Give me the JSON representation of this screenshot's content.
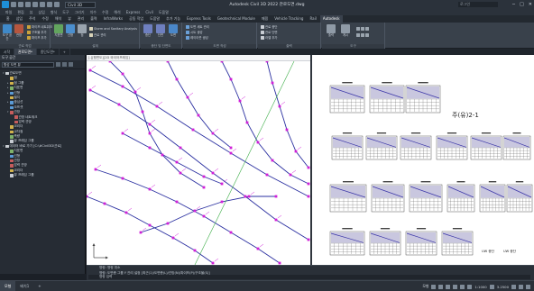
{
  "title": {
    "workspace": "Civil 3D",
    "window_title": "Autodesk Civil 3D 2022   관로도면.dwg",
    "signin": "로그인",
    "controls": [
      "─",
      "□",
      "✕"
    ]
  },
  "menu": [
    "파일",
    "편집",
    "뷰",
    "삽입",
    "형식",
    "도구",
    "그리기",
    "치수",
    "수정",
    "해석",
    "Express",
    "Civil",
    "도움말"
  ],
  "ribbon_tabs": [
    {
      "label": "홈",
      "active": false
    },
    {
      "label": "삽입",
      "active": false
    },
    {
      "label": "주석",
      "active": false
    },
    {
      "label": "수정",
      "active": false
    },
    {
      "label": "해석",
      "active": false
    },
    {
      "label": "뷰",
      "active": false
    },
    {
      "label": "관리",
      "active": false
    },
    {
      "label": "출력",
      "active": false
    },
    {
      "label": "InfraWorks",
      "active": false
    },
    {
      "label": "공동 작업",
      "active": false
    },
    {
      "label": "도움말",
      "active": false
    },
    {
      "label": "추가 기능",
      "active": false
    },
    {
      "label": "Express Tools",
      "active": false
    },
    {
      "label": "Geotechnical Module",
      "active": false
    },
    {
      "label": "매핑",
      "active": false
    },
    {
      "label": "Vehicle Tracking",
      "active": false
    },
    {
      "label": "Rail",
      "active": false
    },
    {
      "label": "Autodesk",
      "active": true
    }
  ],
  "ribbon": {
    "panels": [
      {
        "title": "관로 작업"
      },
      {
        "title": "설계"
      },
      {
        "title": "종단 및 단면도"
      },
      {
        "title": "도면 작성"
      },
      {
        "title": "출력"
      },
      {
        "title": "도구"
      }
    ],
    "big_buttons": [
      "도구 공간",
      "관망",
      "지표면",
      "선형",
      "점",
      "종단",
      "단면",
      "도면",
      "출력",
      "게시"
    ],
    "small_buttons": [
      "파이프 네트워크",
      "구조물 추가",
      "파이프 추가",
      "Storm and Sanitary Analysis",
      "관로 관리",
      "도면 세트 관리",
      "시트 생성",
      "레이아웃 생성",
      "관로 종단",
      "관로 단면",
      "라벨 추가"
    ]
  },
  "doc_tabs": [
    {
      "label": "시작",
      "active": false
    },
    {
      "label": "관로도면*",
      "active": true
    },
    {
      "label": "종단도면*",
      "active": false
    },
    {
      "label": "+",
      "active": false
    }
  ],
  "toolspace": {
    "title": "도구 공간",
    "combo": "활성 도면 뷰",
    "tree": [
      {
        "label": "관로도면",
        "depth": 0,
        "icon": "w",
        "tw": "▾"
      },
      {
        "label": "점",
        "depth": 1,
        "icon": "y",
        "tw": ""
      },
      {
        "label": "점 그룹",
        "depth": 1,
        "icon": "y",
        "tw": "▸"
      },
      {
        "label": "지표면",
        "depth": 1,
        "icon": "g",
        "tw": "▸"
      },
      {
        "label": "선형",
        "depth": 1,
        "icon": "b",
        "tw": "▸"
      },
      {
        "label": "필지",
        "depth": 1,
        "icon": "y",
        "tw": ""
      },
      {
        "label": "중심선",
        "depth": 1,
        "icon": "b",
        "tw": "▸"
      },
      {
        "label": "오프셋",
        "depth": 1,
        "icon": "b",
        "tw": ""
      },
      {
        "label": "관망",
        "depth": 1,
        "icon": "r",
        "tw": "▾"
      },
      {
        "label": "관망 네트워크",
        "depth": 2,
        "icon": "r",
        "tw": ""
      },
      {
        "label": "압력 관망",
        "depth": 2,
        "icon": "r",
        "tw": ""
      },
      {
        "label": "코리더",
        "depth": 1,
        "icon": "y",
        "tw": ""
      },
      {
        "label": "교차점",
        "depth": 1,
        "icon": "y",
        "tw": ""
      },
      {
        "label": "측량",
        "depth": 1,
        "icon": "g",
        "tw": ""
      },
      {
        "label": "뷰 프레임 그룹",
        "depth": 1,
        "icon": "w",
        "tw": ""
      },
      {
        "label": "데이터 바로 가기 [C:\\#Civil3D\\관로]",
        "depth": 0,
        "icon": "w",
        "tw": "▾"
      },
      {
        "label": "지표면",
        "depth": 1,
        "icon": "g",
        "tw": ""
      },
      {
        "label": "선형",
        "depth": 1,
        "icon": "b",
        "tw": ""
      },
      {
        "label": "관망",
        "depth": 1,
        "icon": "r",
        "tw": ""
      },
      {
        "label": "압력 관망",
        "depth": 1,
        "icon": "r",
        "tw": ""
      },
      {
        "label": "코리더",
        "depth": 1,
        "icon": "y",
        "tw": ""
      },
      {
        "label": "뷰 프레임 그룹",
        "depth": 1,
        "icon": "w",
        "tw": ""
      }
    ]
  },
  "model_view": {
    "viewport_label": "[-][평면도][2D 와이어프레임]"
  },
  "layout": {
    "sheet_title": "주(유)2-1",
    "labels": [
      "UW 종단",
      "UW 종단"
    ]
  },
  "command_line": {
    "history": [
      "명령: 명령 취소",
      "명령: 도면층 그룹 Y 관리 설정 [최근(1)/도면층(L)/관망(N)/파이프(P)/구조물(S)]"
    ],
    "input": "명령 입력"
  },
  "status": {
    "tabs": [
      {
        "label": "모형",
        "active": true
      },
      {
        "label": "배치1",
        "active": false
      },
      {
        "label": "+",
        "active": false
      }
    ],
    "scale": "1:1000",
    "coords": "3.2500",
    "mode": "모형"
  },
  "colors": {
    "pipe": "#2a2fa0",
    "structure": "#d01fd8",
    "frame": "#2c2c2c",
    "accent": "#1e8fd8"
  }
}
